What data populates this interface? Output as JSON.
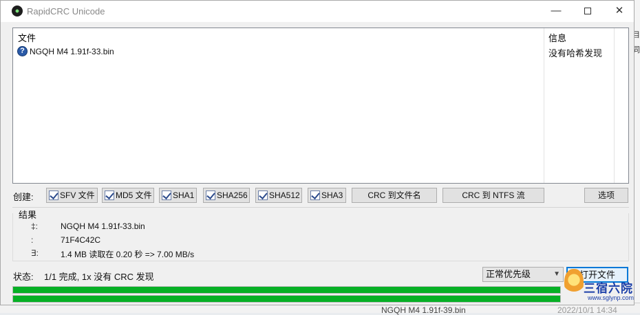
{
  "window": {
    "title": "RapidCRC Unicode",
    "controls": {
      "minimize": "—",
      "close": "✕"
    }
  },
  "file_list": {
    "columns": [
      "文件",
      "信息"
    ],
    "rows": [
      {
        "name": "NGQH M4 1.91f-33.bin",
        "info": "没有哈希发现",
        "icon": "question-icon"
      }
    ]
  },
  "create": {
    "label": "创建:",
    "hash_buttons": [
      "SFV 文件",
      "MD5 文件",
      "SHA1",
      "SHA256",
      "SHA512",
      "SHA3"
    ],
    "crc_filename_button": "CRC 到文件名",
    "crc_ntfs_button": "CRC 到 NTFS 流",
    "options_button": "选项"
  },
  "results": {
    "title": "结果",
    "rows": [
      {
        "label": "‡:",
        "value": "NGQH M4 1.91f-33.bin"
      },
      {
        "label": ":",
        "value": "71F4C42C"
      },
      {
        "label": "∃:",
        "value": "1.4 MB 读取在 0.20 秒 => 7.00 MB/s"
      }
    ]
  },
  "status": {
    "label": "状态:",
    "text": "1/1 完成, 1x 没有 CRC 发现",
    "priority": "正常优先级",
    "open_button": "打开文件"
  },
  "progress": {
    "bar1": 1.0,
    "bar2": 1.0,
    "color": "#06b025"
  },
  "background": {
    "file": "NGQH M4 1.91f-39.bin",
    "date": "2022/10/1 14:34"
  },
  "watermark": {
    "brand": "三宿六院",
    "url": "www.sglynp.com"
  }
}
